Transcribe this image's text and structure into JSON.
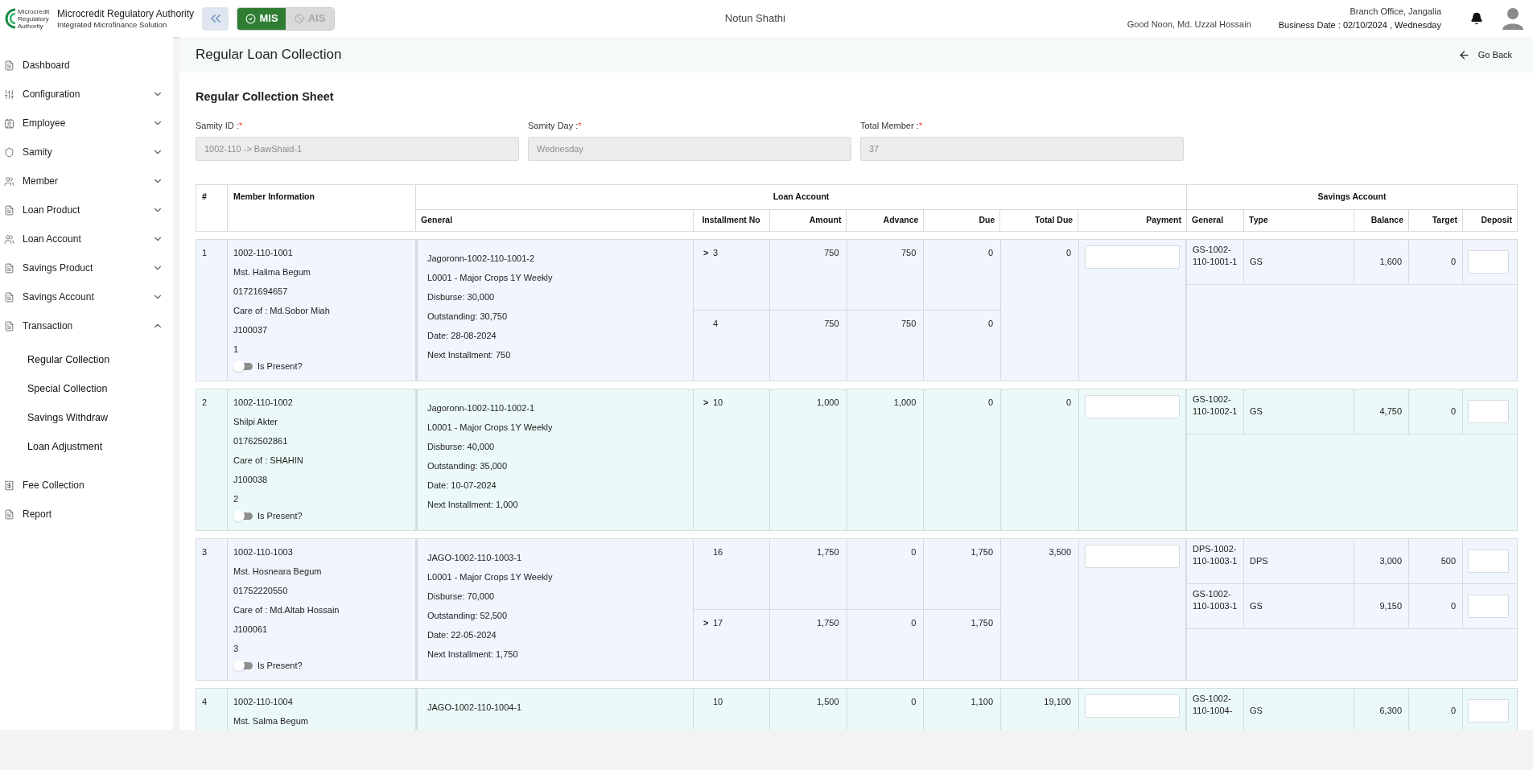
{
  "header": {
    "logo_text": "Microcredit Regulatory Authority",
    "org_name": "Microcredit Regulatory Authority",
    "org_subtitle": "Integrated Microfinance Solution",
    "modules": [
      {
        "label": "MIS",
        "selected": true,
        "disabled": false
      },
      {
        "label": "AIS",
        "selected": false,
        "disabled": true
      }
    ],
    "app_name": "Notun Shathi",
    "greeting": "Good Noon, Md. Uzzal Hossain",
    "branch": "Branch Office, Jangalia",
    "business_date": "Business Date : 02/10/2024 , Wednesday"
  },
  "sidebar": {
    "items": [
      {
        "label": "Dashboard",
        "kind": "link"
      },
      {
        "label": "Configuration",
        "kind": "group",
        "expanded": false
      },
      {
        "label": "Employee",
        "kind": "group",
        "expanded": false
      },
      {
        "label": "Samity",
        "kind": "group",
        "expanded": false
      },
      {
        "label": "Member",
        "kind": "group",
        "expanded": false
      },
      {
        "label": "Loan Product",
        "kind": "group",
        "expanded": false
      },
      {
        "label": "Loan Account",
        "kind": "group",
        "expanded": false
      },
      {
        "label": "Savings Product",
        "kind": "group",
        "expanded": false
      },
      {
        "label": "Savings Account",
        "kind": "group",
        "expanded": false
      },
      {
        "label": "Transaction",
        "kind": "group",
        "expanded": true,
        "children": [
          {
            "label": "Regular Collection"
          },
          {
            "label": "Special Collection"
          },
          {
            "label": "Savings Withdraw"
          },
          {
            "label": "Loan Adjustment"
          }
        ]
      },
      {
        "label": "Fee Collection",
        "kind": "link"
      },
      {
        "label": "Report",
        "kind": "link"
      }
    ]
  },
  "page": {
    "title": "Regular Loan Collection",
    "go_back": "Go Back",
    "sheet_title": "Regular Collection Sheet",
    "fields": [
      {
        "label": "Samity ID :",
        "required_mark": "*",
        "value": "1002-110 -> BawShaid-1"
      },
      {
        "label": "Samity Day :",
        "required_mark": "*",
        "value": "Wednesday"
      },
      {
        "label": "Total Member :",
        "required_mark": "*",
        "value": "37"
      }
    ]
  },
  "table": {
    "number_header": "#",
    "member_header": "Member Information",
    "loan_header": "Loan Account",
    "savings_header": "Savings Account",
    "loan_columns": [
      "General",
      "Installment No",
      "Amount",
      "Advance",
      "Due",
      "Total Due",
      "Payment"
    ],
    "savings_columns": [
      "General",
      "Type",
      "Balance",
      "Target",
      "Deposit"
    ],
    "rows": [
      {
        "number": "1",
        "member_lines": [
          "1002-110-1001",
          "Mst. Halima Begum",
          "01721694657",
          "Care of : Md.Sobor Miah",
          "J100037",
          "1"
        ],
        "present": false,
        "present_label": "Is Present?",
        "loan_lines": [
          "Jagoronn-1002-110-1001-2",
          "L0001 - Major Crops 1Y Weekly",
          "Disburse: 30,000",
          "Outstanding: 30,750",
          "Date: 28-08-2024",
          "Next Installment: 750"
        ],
        "installments": [
          {
            "marker": ">",
            "no": "3",
            "amount": "750",
            "advance": "750",
            "due": "0"
          },
          {
            "no": "4",
            "amount": "750",
            "advance": "750",
            "due": "0"
          }
        ],
        "total_due": "0",
        "savings": [
          {
            "general": "GS-1002-110-1001-1",
            "type": "GS",
            "balance": "1,600",
            "target": "0"
          }
        ]
      },
      {
        "number": "2",
        "member_lines": [
          "1002-110-1002",
          "Shilpi Akter",
          "01762502861",
          "Care of : SHAHIN",
          "J100038",
          "2"
        ],
        "present": false,
        "present_label": "Is Present?",
        "loan_lines": [
          "Jagoronn-1002-110-1002-1",
          "L0001 - Major Crops 1Y Weekly",
          "Disburse: 40,000",
          "Outstanding: 35,000",
          "Date: 10-07-2024",
          "Next Installment: 1,000"
        ],
        "installments": [
          {
            "marker": ">",
            "no": "10",
            "amount": "1,000",
            "advance": "1,000",
            "due": "0"
          }
        ],
        "total_due": "0",
        "savings": [
          {
            "general": "GS-1002-110-1002-1",
            "type": "GS",
            "balance": "4,750",
            "target": "0"
          }
        ]
      },
      {
        "number": "3",
        "member_lines": [
          "1002-110-1003",
          "Mst. Hosneara Begum",
          "01752220550",
          "Care of : Md.Altab Hossain",
          "J100061",
          "3"
        ],
        "present": false,
        "present_label": "Is Present?",
        "loan_lines": [
          "JAGO-1002-110-1003-1",
          "L0001 - Major Crops 1Y Weekly",
          "Disburse: 70,000",
          "Outstanding: 52,500",
          "Date: 22-05-2024",
          "Next Installment: 1,750"
        ],
        "installments": [
          {
            "no": "16",
            "amount": "1,750",
            "advance": "0",
            "due": "1,750"
          },
          {
            "marker": ">",
            "no": "17",
            "amount": "1,750",
            "advance": "0",
            "due": "1,750"
          }
        ],
        "total_due": "3,500",
        "savings": [
          {
            "general": "DPS-1002-110-1003-1",
            "type": "DPS",
            "balance": "3,000",
            "target": "500"
          },
          {
            "general": "GS-1002-110-1003-1",
            "type": "GS",
            "balance": "9,150",
            "target": "0"
          }
        ]
      },
      {
        "number": "4",
        "member_lines": [
          "1002-110-1004",
          "Mst. Salma Begum"
        ],
        "loan_lines": [
          "JAGO-1002-110-1004-1"
        ],
        "installments": [
          {
            "no": "10",
            "amount": "1,500",
            "advance": "0",
            "due": "1,100"
          }
        ],
        "total_due": "19,100",
        "savings": [
          {
            "general": "GS-1002-110-1004-",
            "type": "GS",
            "balance": "6,300",
            "target": "0"
          }
        ]
      }
    ]
  }
}
